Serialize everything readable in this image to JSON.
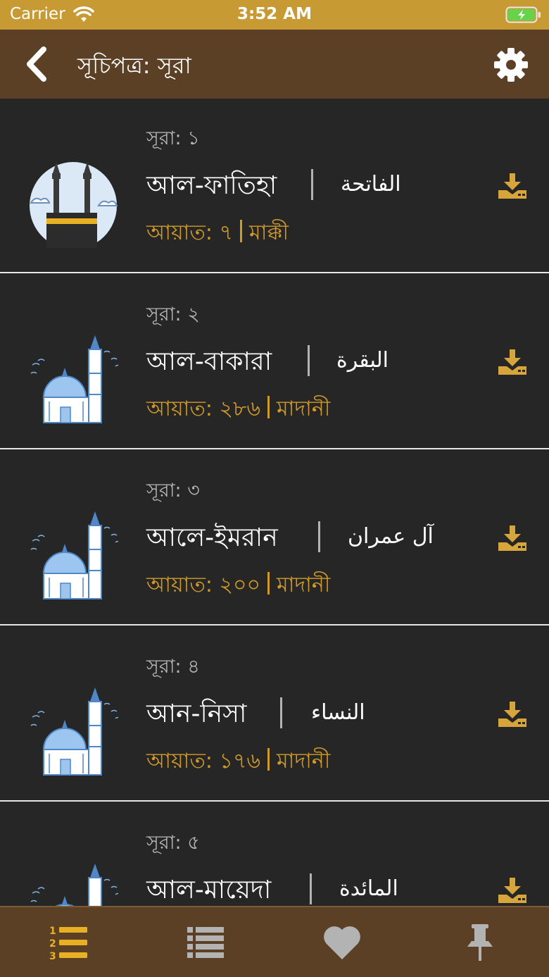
{
  "status_bar": {
    "carrier": "Carrier",
    "time": "3:52 AM"
  },
  "nav": {
    "title": "সূচিপত্র: সূরা",
    "back_icon": "chevron-left-icon",
    "settings_icon": "gear-icon"
  },
  "colors": {
    "status_bar": "#c79a34",
    "nav_bar": "#5c4025",
    "background": "#262626",
    "accent": "#d19a26"
  },
  "suras": [
    {
      "number_label": "সূরা: ১",
      "name": "আল-ফাতিহা",
      "arabic": "الفاتحة",
      "ayat": "আয়াত: ৭",
      "type": "মাক্কী",
      "icon": "kaaba-icon"
    },
    {
      "number_label": "সূরা: ২",
      "name": "আল-বাকারা",
      "arabic": "البقرة",
      "ayat": "আয়াত: ২৮৬",
      "type": "মাদানী",
      "icon": "mosque-icon"
    },
    {
      "number_label": "সূরা: ৩",
      "name": "আলে-ইমরান",
      "arabic": "آل عمران",
      "ayat": "আয়াত: ২০০",
      "type": "মাদানী",
      "icon": "mosque-icon"
    },
    {
      "number_label": "সূরা: ৪",
      "name": "আন-নিসা",
      "arabic": "النساء",
      "ayat": "আয়াত: ১৭৬",
      "type": "মাদানী",
      "icon": "mosque-icon"
    },
    {
      "number_label": "সূরা: ৫",
      "name": "আল-মায়েদা",
      "arabic": "المائدة",
      "ayat": "",
      "type": "",
      "icon": "mosque-icon"
    }
  ],
  "tabs": [
    {
      "icon": "numbered-list-icon",
      "active": true
    },
    {
      "icon": "list-icon",
      "active": false
    },
    {
      "icon": "heart-icon",
      "active": false
    },
    {
      "icon": "pin-icon",
      "active": false
    }
  ]
}
